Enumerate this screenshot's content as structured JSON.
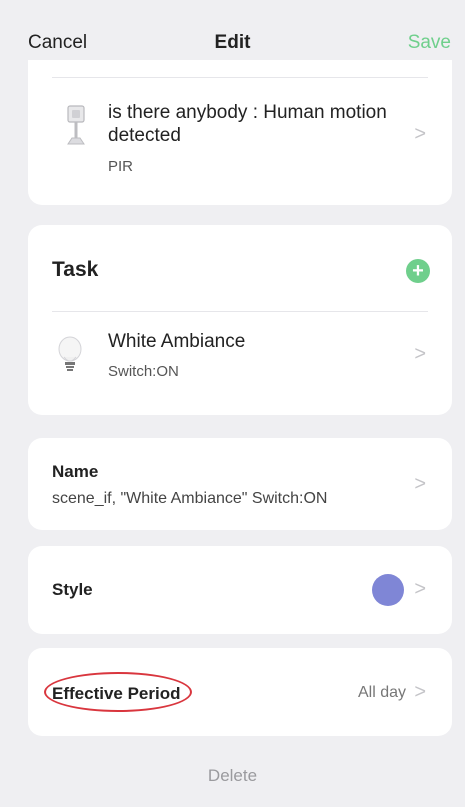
{
  "nav": {
    "cancel": "Cancel",
    "title": "Edit",
    "save": "Save"
  },
  "condition": {
    "title": "is there anybody : Human motion detected",
    "subtitle": "PIR",
    "icon": "motion-sensor-icon"
  },
  "task": {
    "label": "Task",
    "add_icon": "plus-icon",
    "item": {
      "title": "White Ambiance",
      "subtitle": "Switch:ON",
      "icon": "lightbulb-icon"
    }
  },
  "name": {
    "label": "Name",
    "value": "scene_if, \"White Ambiance\" Switch:ON"
  },
  "style": {
    "label": "Style",
    "color": "#7f86d6"
  },
  "effective_period": {
    "label": "Effective Period",
    "value": "All day"
  },
  "delete": "Delete",
  "colors": {
    "accent": "#6fcf8c",
    "highlight": "#d9363e"
  }
}
